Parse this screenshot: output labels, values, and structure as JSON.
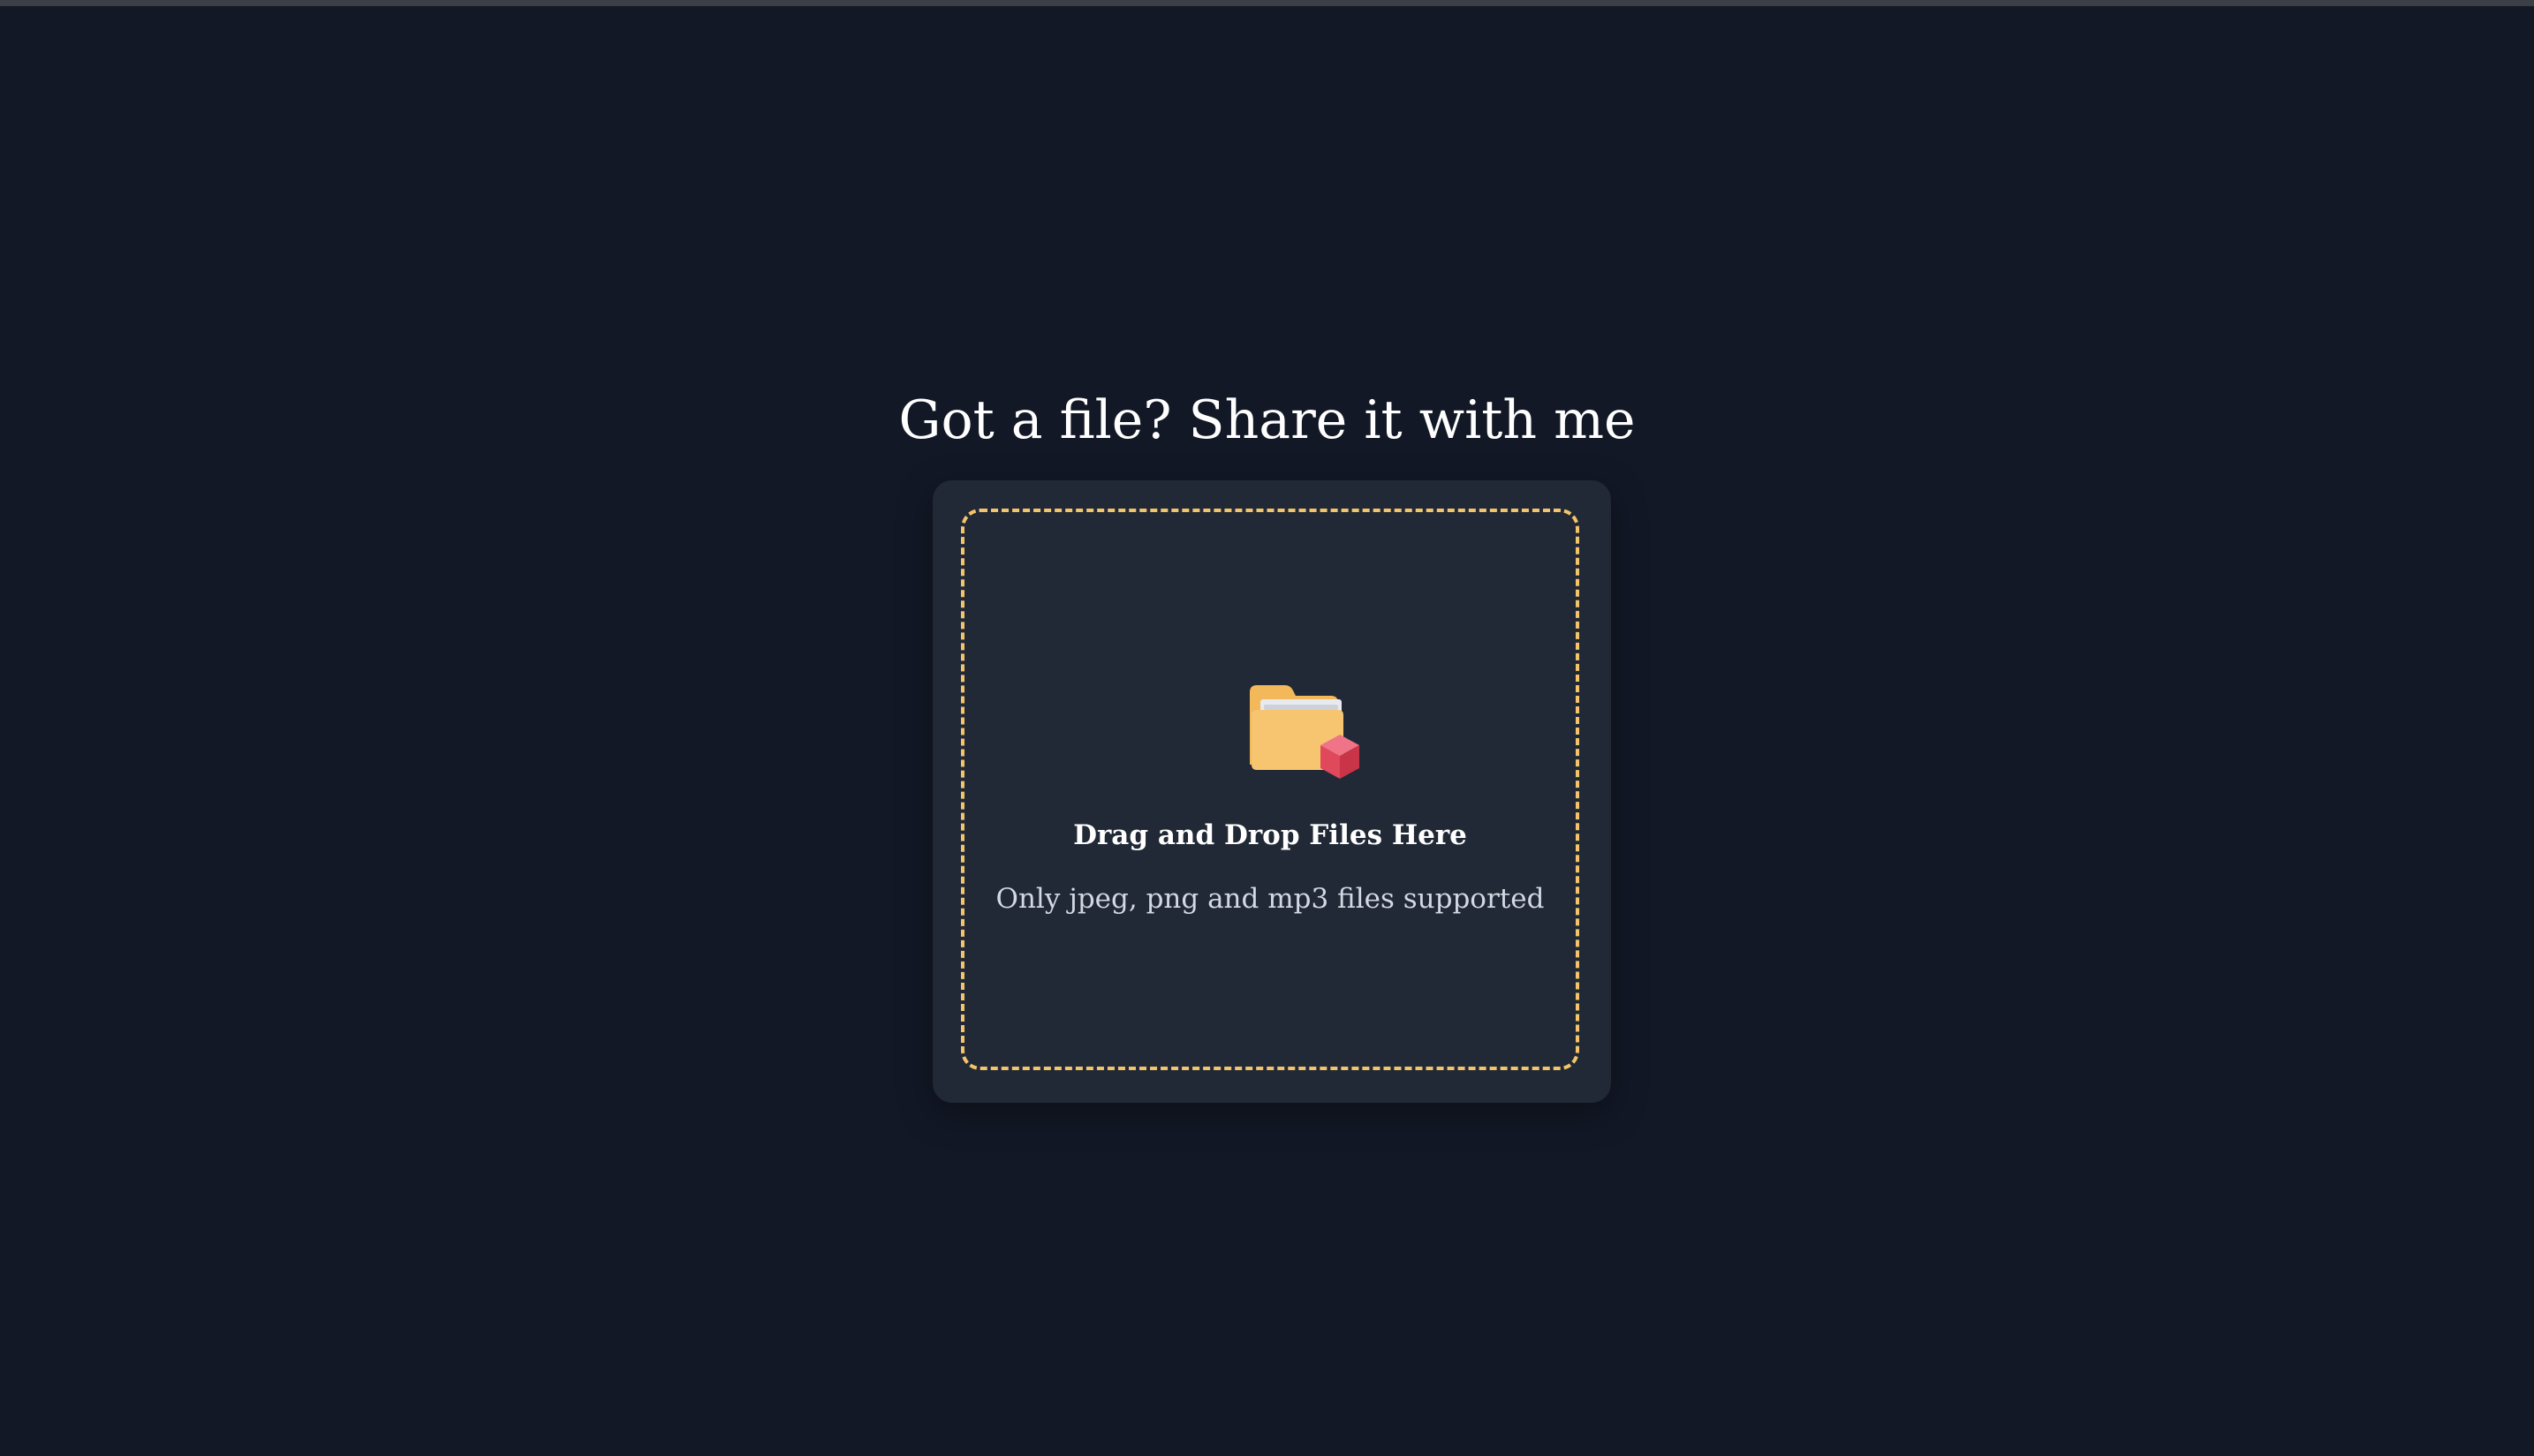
{
  "page": {
    "title": "Got a file? Share it with me"
  },
  "dropzone": {
    "label": "Drag and Drop Files Here",
    "hint": "Only jpeg, png and mp3 files supported",
    "icon": "folder-with-cube-icon"
  },
  "colors": {
    "background": "#121826",
    "card": "#212936",
    "dashed_border": "#f3c46b",
    "folder": "#f7c56f",
    "cube": "#e0485c"
  }
}
